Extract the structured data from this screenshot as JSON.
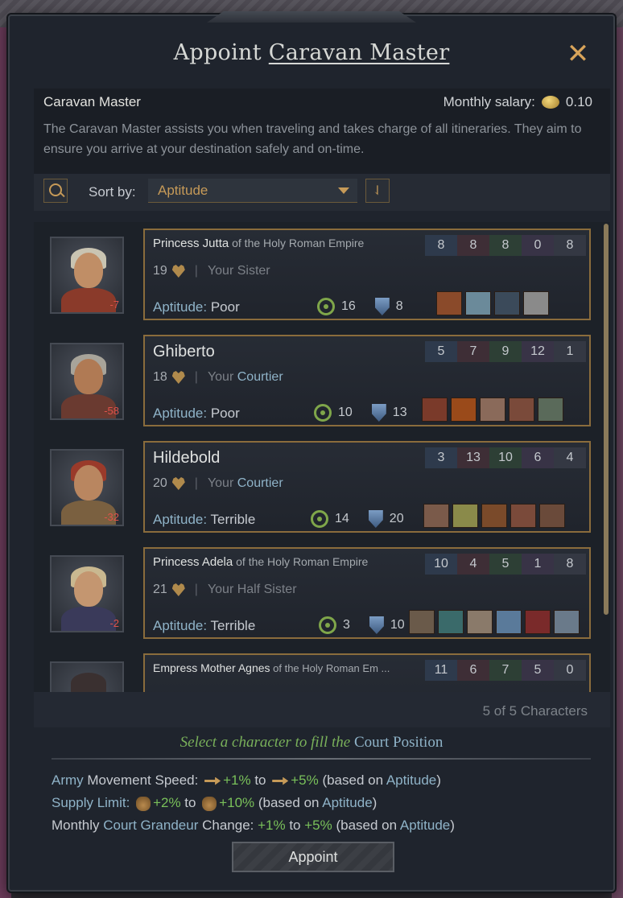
{
  "window": {
    "title_prefix": "Appoint",
    "title_position": "Caravan Master",
    "close_glyph": "✕"
  },
  "info": {
    "position_name": "Caravan Master",
    "salary_label": "Monthly salary:",
    "salary_value": "0.10",
    "description": "The Caravan Master assists you when traveling and takes charge of all itineraries. They aim to ensure you arrive at your destination safely and on-time."
  },
  "sort": {
    "label": "Sort by:",
    "selected": "Aptitude",
    "order_glyph": "⇃"
  },
  "characters": [
    {
      "name": "Princess Jutta",
      "suffix": " of the Holy Roman Empire",
      "age": "19",
      "relation_prefix": "Your Sister",
      "relation_highlight": "",
      "aptitude_label": "Aptitude:",
      "aptitude": "Poor",
      "portrait_value": "-7",
      "skills": [
        "8",
        "8",
        "8",
        "0",
        "8"
      ],
      "travel_speed": "16",
      "travel_safety": "8",
      "traits": [
        "#8a4a2a",
        "#6b8a9a",
        "#3b4a5a",
        "#8a8a8a"
      ]
    },
    {
      "name": "Ghiberto",
      "suffix": "",
      "age": "18",
      "relation_prefix": "Your ",
      "relation_highlight": "Courtier",
      "aptitude_label": "Aptitude:",
      "aptitude": "Poor",
      "portrait_value": "-58",
      "skills": [
        "5",
        "7",
        "9",
        "12",
        "1"
      ],
      "travel_speed": "10",
      "travel_safety": "13",
      "traits": [
        "#7a3a2a",
        "#9a4a1a",
        "#8a6a5a",
        "#7a4a3a",
        "#5a6a5a"
      ]
    },
    {
      "name": "Hildebold",
      "suffix": "",
      "age": "20",
      "relation_prefix": "Your ",
      "relation_highlight": "Courtier",
      "aptitude_label": "Aptitude:",
      "aptitude": "Terrible",
      "portrait_value": "-32",
      "skills": [
        "3",
        "13",
        "10",
        "6",
        "4"
      ],
      "travel_speed": "14",
      "travel_safety": "20",
      "traits": [
        "#7a5a4a",
        "#8a8a4a",
        "#7a4a2a",
        "#7a4a3a",
        "#6a4a3a"
      ]
    },
    {
      "name": "Princess Adela",
      "suffix": " of the Holy Roman Empire",
      "age": "21",
      "relation_prefix": "Your Half Sister",
      "relation_highlight": "",
      "aptitude_label": "Aptitude:",
      "aptitude": "Terrible",
      "portrait_value": "-2",
      "skills": [
        "10",
        "4",
        "5",
        "1",
        "8"
      ],
      "travel_speed": "3",
      "travel_safety": "10",
      "traits": [
        "#6a5a4a",
        "#3a6a6a",
        "#8a7a6a",
        "#5a7a9a",
        "#7a2a2a",
        "#6a7a8a"
      ]
    },
    {
      "name": "Empress Mother Agnes",
      "suffix": " of the Holy Roman Em ...",
      "skills": [
        "11",
        "6",
        "7",
        "5",
        "0"
      ]
    }
  ],
  "count_text": "5 of 5 Characters",
  "hint": {
    "prefix": "Select a character to fill the ",
    "highlight": "Court Position"
  },
  "effects": {
    "army_label": "Army",
    "army_rest": " Movement Speed: ",
    "army_min": "+1%",
    "army_to": " to ",
    "army_max": "+5%",
    "supply_label": "Supply Limit:",
    "supply_min": "+2%",
    "supply_to": " to ",
    "supply_max": "+10%",
    "grandeur_prefix": "Monthly ",
    "grandeur_label": "Court Grandeur",
    "grandeur_rest": " Change: ",
    "grandeur_min": "+1%",
    "grandeur_to": " to ",
    "grandeur_max": "+5%",
    "based_prefix": " (based on ",
    "based_word": "Aptitude",
    "based_suffix": ")"
  },
  "appoint_label": "Appoint"
}
